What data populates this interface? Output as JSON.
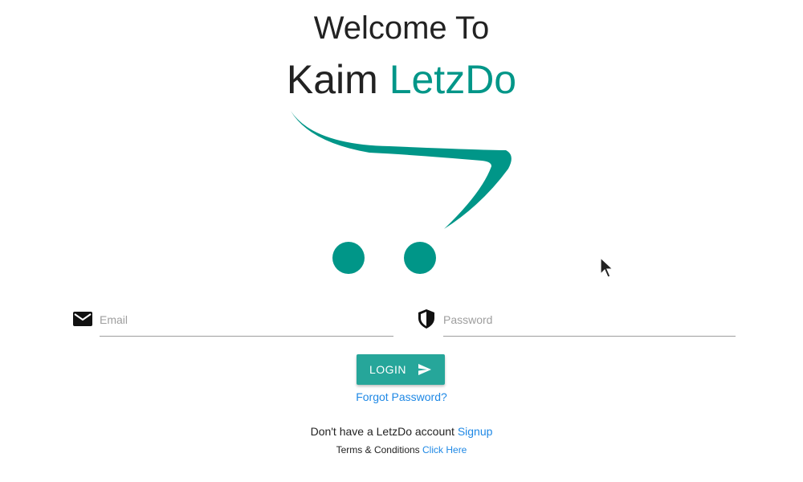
{
  "header": {
    "welcome": "Welcome To",
    "brand_first": "Kaim",
    "brand_accent": "LetzDo"
  },
  "logo": {
    "icon": "shopping-cart-icon",
    "color": "#009688"
  },
  "form": {
    "email": {
      "placeholder": "Email",
      "icon": "mail-icon"
    },
    "password": {
      "placeholder": "Password",
      "icon": "shield-icon"
    },
    "login_label": "LOGIN",
    "login_icon": "send-icon",
    "forgot_label": "Forgot Password?"
  },
  "footer": {
    "signup_text": "Don't have a LetzDo account",
    "signup_link": "Signup",
    "terms_text": "Terms & Conditions",
    "terms_link": "Click Here"
  },
  "colors": {
    "accent": "#009688",
    "button": "#26a69a",
    "link": "#1e88e5"
  }
}
